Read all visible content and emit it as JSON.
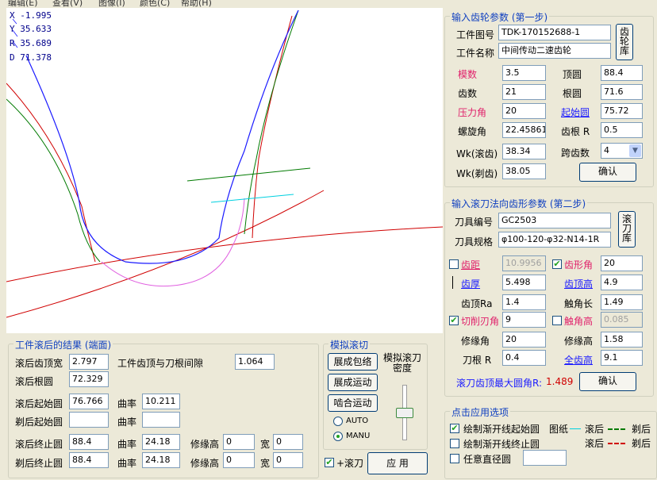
{
  "menu": [
    "编辑(E)",
    "查看(V)",
    "图像(I)",
    "颜色(C)",
    "帮助(H)"
  ],
  "readout": {
    "x": "X -1.995",
    "y": "Y 35.633",
    "r": "R 35.689",
    "d": "D 71.378"
  },
  "step1": {
    "title": "输入齿轮参数 (第一步)",
    "drawing_no_label": "工件图号",
    "drawing_no": "TDK-170152688-1",
    "part_name_label": "工件名称",
    "part_name": "中间传动二速齿轮",
    "gear_lib_button": "齿轮库",
    "module_label": "模数",
    "module": "3.5",
    "tip_circle_label": "顶圆",
    "tip_circle": "88.4",
    "teeth_label": "齿数",
    "teeth": "21",
    "root_circle_label": "根圆",
    "root_circle": "71.6",
    "pressure_angle_label": "压力角",
    "pressure_angle": "20",
    "start_circle_label": "起始圆",
    "start_circle": "75.72",
    "helix_angle_label": "螺旋角",
    "helix_angle": "22.45861",
    "root_r_label": "齿根 R",
    "root_r": "0.5",
    "wk_hob_label": "Wk(滚齿)",
    "wk_hob": "38.34",
    "span_teeth_label": "跨齿数",
    "span_teeth": "4",
    "wk_shave_label": "Wk(剃齿)",
    "wk_shave": "38.05",
    "confirm": "确认"
  },
  "step2": {
    "title": "输入滚刀法向齿形参数 (第二步)",
    "tool_no_label": "刀具编号",
    "tool_no": "GC2503",
    "tool_spec_label": "刀具规格",
    "tool_spec": "φ100-120-φ32-N14-1R",
    "hob_lib_button": "滚刀库",
    "pitch_label": "齿距",
    "pitch": "10.9956",
    "pitch_checked": false,
    "profile_angle_label": "齿形角",
    "profile_angle": "20",
    "profile_angle_checked": true,
    "thickness_label": "齿厚",
    "thickness": "5.498",
    "addendum_label": "齿顶高",
    "addendum": "4.9",
    "tip_ra_label": "齿顶Ra",
    "tip_ra": "1.4",
    "contact_len_label": "触角长",
    "contact_len": "1.49",
    "cut_angle_label": "切削刃角",
    "cut_angle": "9",
    "cut_angle_checked": true,
    "contact_height_label": "触角高",
    "contact_height": "0.085",
    "contact_height_checked": false,
    "mod_angle_label": "修缘角",
    "mod_angle": "20",
    "mod_height_label": "修缘高",
    "mod_height": "1.58",
    "tool_root_r_label": "刀根 R",
    "tool_root_r": "0.4",
    "full_height_label": "全齿高",
    "full_height": "9.1",
    "max_tip_r_label": "滚刀齿顶最大圆角R:",
    "max_tip_r": "1.489",
    "confirm": "确认"
  },
  "sim": {
    "title": "模拟滚切",
    "btn_envelope": "展成包络",
    "btn_generate": "展成运动",
    "btn_mesh": "啮合运动",
    "density_label": "模拟滚刀密度",
    "auto": "AUTO",
    "manu": "MANU",
    "mode": "MANU",
    "plus_hob_label": "+滚刀",
    "plus_hob_checked": true,
    "apply": "应 用"
  },
  "result": {
    "title": "工件滚后的结果 (端面)",
    "tip_width_label": "滚后齿顶宽",
    "tip_width": "2.797",
    "clearance_label": "工件齿顶与刀根间隙",
    "clearance": "1.064",
    "root_circle_label": "滚后根圆",
    "root_circle": "72.329",
    "start_label": "滚后起始圆",
    "start": "76.766",
    "curv_label": "曲率",
    "start_curv": "10.211",
    "shave_start_label": "剃后起始圆",
    "shave_start": "",
    "shave_start_curv": "",
    "end_label": "滚后终止圆",
    "end": "88.4",
    "end_curv": "24.18",
    "mod_h_label": "修缘高",
    "end_mod_h": "0",
    "width_label": "宽",
    "end_width": "0",
    "shave_end_label": "剃后终止圆",
    "shave_end": "88.4",
    "shave_end_curv": "24.18",
    "shave_end_mod_h": "0",
    "shave_end_width": "0"
  },
  "apply_opts": {
    "title": "点击应用选项",
    "draw_start_label": "绘制渐开线起始圆",
    "draw_start_checked": true,
    "draw_end_label": "绘制渐开线终止圆",
    "draw_end_checked": false,
    "any_circle_label": "任意直径圆",
    "any_circle_checked": false,
    "any_circle_value": "",
    "legend_title": "图纸",
    "legend_hob": "滚后",
    "legend_shave": "剃后"
  },
  "colors": {
    "blue_curve": "#1a1aff",
    "green_curve": "#007a00",
    "red_curve": "#d00000",
    "magenta_curve": "#e060e0",
    "cyan_line": "#00d0e0"
  }
}
